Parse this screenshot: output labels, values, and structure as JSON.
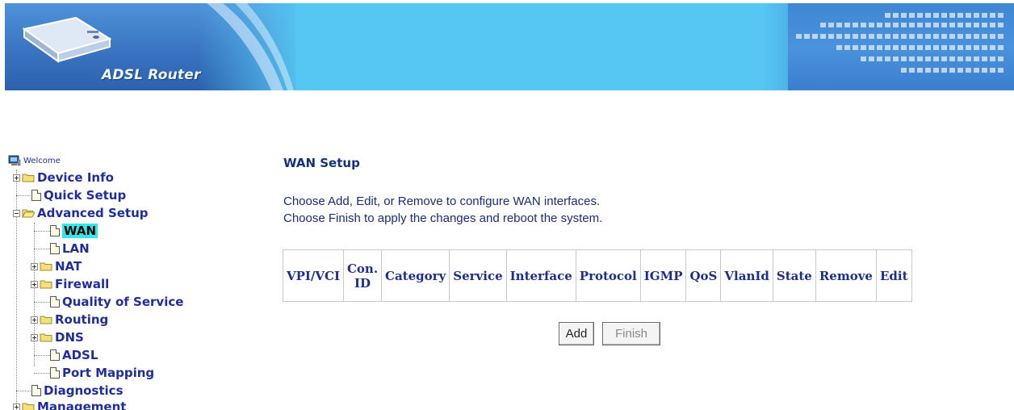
{
  "banner": {
    "logo_text": "ADSL Router"
  },
  "nav": {
    "welcome": "Welcome",
    "items": [
      {
        "label": "Device Info"
      },
      {
        "label": "Quick Setup"
      },
      {
        "label": "Advanced Setup"
      },
      {
        "label": "WAN",
        "selected": true
      },
      {
        "label": "LAN"
      },
      {
        "label": "NAT"
      },
      {
        "label": "Firewall"
      },
      {
        "label": "Quality of Service"
      },
      {
        "label": "Routing"
      },
      {
        "label": "DNS"
      },
      {
        "label": "ADSL"
      },
      {
        "label": "Port Mapping"
      },
      {
        "label": "Diagnostics"
      },
      {
        "label": "Management"
      }
    ]
  },
  "main": {
    "title": "WAN Setup",
    "instructions": [
      "Choose Add, Edit, or Remove to configure WAN interfaces.",
      "Choose Finish to apply the changes and reboot the system."
    ],
    "table_headers": [
      "VPI/VCI",
      "Con. ID",
      "Category",
      "Service",
      "Interface",
      "Protocol",
      "IGMP",
      "QoS",
      "VlanId",
      "State",
      "Remove",
      "Edit"
    ],
    "buttons": {
      "add": "Add",
      "finish": "Finish"
    }
  },
  "colors": {
    "banner": "#56c6f2",
    "nav_text": "#1f2e9c",
    "selected_bg": "#2ee8ea"
  }
}
